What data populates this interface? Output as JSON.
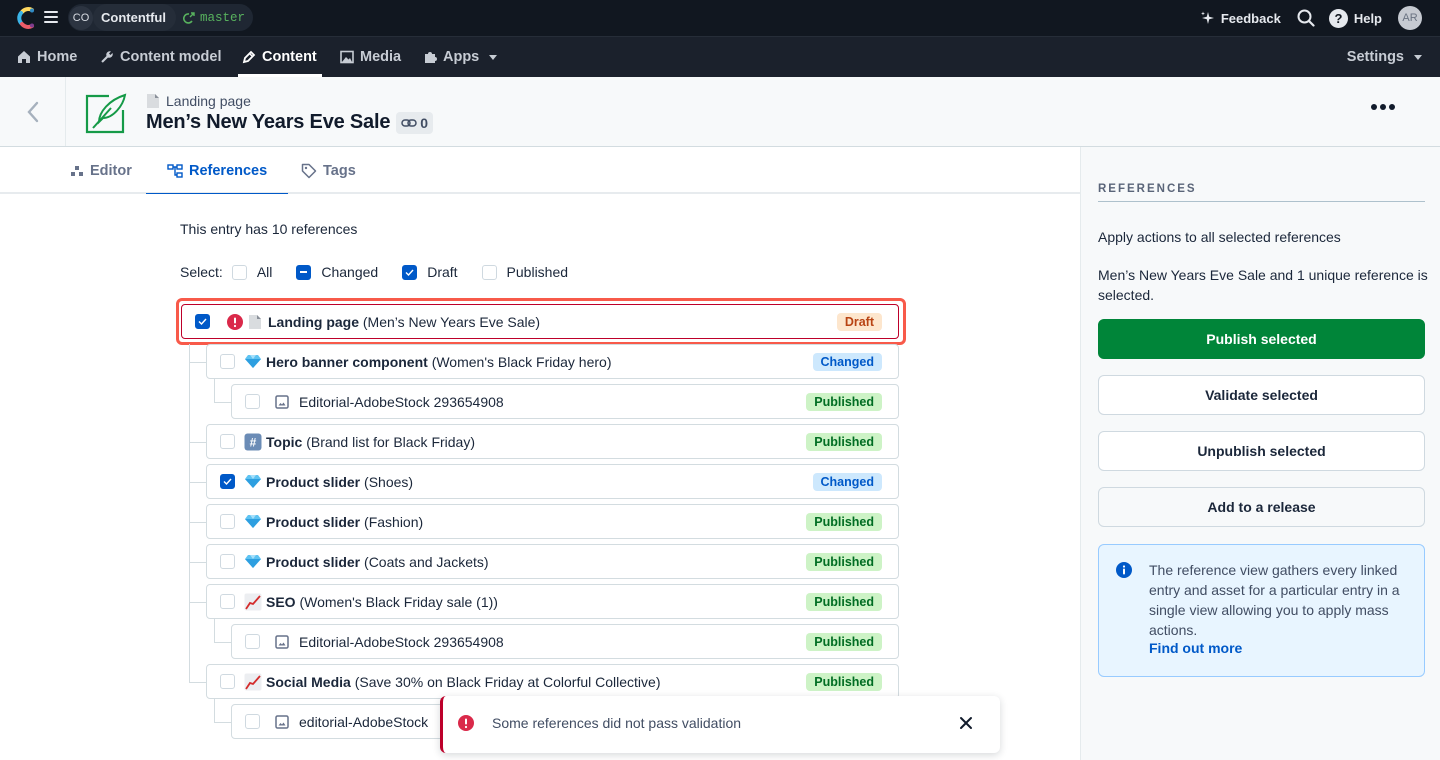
{
  "topbar": {
    "space_initials": "CO",
    "space_name": "Contentful",
    "environment": "master",
    "feedback_label": "Feedback",
    "help_label": "Help",
    "user_initials": "AR"
  },
  "nav": {
    "items": [
      {
        "label": "Home",
        "icon": "home-icon"
      },
      {
        "label": "Content model",
        "icon": "wrench-icon"
      },
      {
        "label": "Content",
        "icon": "pen-icon",
        "active": true
      },
      {
        "label": "Media",
        "icon": "image-icon"
      },
      {
        "label": "Apps",
        "icon": "puzzle-icon",
        "dropdown": true
      }
    ],
    "settings_label": "Settings"
  },
  "entry": {
    "content_type": "Landing page",
    "title": "Men’s New Years Eve Sale",
    "link_count": "0"
  },
  "tabs": [
    {
      "label": "Editor",
      "icon": "editor-icon"
    },
    {
      "label": "References",
      "icon": "references-icon",
      "active": true
    },
    {
      "label": "Tags",
      "icon": "tag-icon"
    }
  ],
  "references": {
    "summary": "This entry has 10 references",
    "select_label": "Select:",
    "select_options": [
      {
        "label": "All",
        "state": "unchecked"
      },
      {
        "label": "Changed",
        "state": "indeterminate"
      },
      {
        "label": "Draft",
        "state": "checked"
      },
      {
        "label": "Published",
        "state": "unchecked"
      }
    ],
    "items": [
      {
        "type": "Landing page",
        "name": "(Men’s New Years Eve Sale)",
        "status": "Draft",
        "checked": true,
        "error": true,
        "icon": "page-icon",
        "level": 0
      },
      {
        "type": "Hero banner component",
        "name": "(Women's Black Friday hero)",
        "status": "Changed",
        "checked": false,
        "icon": "gem-icon",
        "level": 1
      },
      {
        "type": "",
        "name": "Editorial-AdobeStock 293654908",
        "status": "Published",
        "checked": false,
        "icon": "image-icon",
        "level": 2
      },
      {
        "type": "Topic",
        "name": "(Brand list for Black Friday)",
        "status": "Published",
        "checked": false,
        "icon": "hash-icon",
        "level": 1
      },
      {
        "type": "Product slider",
        "name": "(Shoes)",
        "status": "Changed",
        "checked": true,
        "icon": "gem-icon",
        "level": 1
      },
      {
        "type": "Product slider",
        "name": "(Fashion)",
        "status": "Published",
        "checked": false,
        "icon": "gem-icon",
        "level": 1
      },
      {
        "type": "Product slider",
        "name": "(Coats and Jackets)",
        "status": "Published",
        "checked": false,
        "icon": "gem-icon",
        "level": 1
      },
      {
        "type": "SEO",
        "name": "(Women's Black Friday sale (1))",
        "status": "Published",
        "checked": false,
        "icon": "chart-icon",
        "level": 1
      },
      {
        "type": "",
        "name": "Editorial-AdobeStock 293654908",
        "status": "Published",
        "checked": false,
        "icon": "image-icon",
        "level": 2
      },
      {
        "type": "Social Media",
        "name": "(Save 30% on Black Friday at Colorful Collective)",
        "status": "Published",
        "checked": false,
        "icon": "chart-icon",
        "level": 1
      },
      {
        "type": "",
        "name": "editorial-AdobeStock",
        "status": "",
        "checked": false,
        "icon": "image-icon",
        "level": 2
      }
    ]
  },
  "toast": {
    "message": "Some references did not pass validation"
  },
  "sidebar": {
    "heading": "REFERENCES",
    "description": "Apply actions to all selected references",
    "selection_text": "Men’s New Years Eve Sale and 1 unique reference is selected.",
    "buttons": {
      "publish": "Publish selected",
      "validate": "Validate selected",
      "unpublish": "Unpublish selected",
      "release": "Add to a release"
    },
    "note": {
      "text": "The reference view gathers every linked entry and asset for a particular entry in a single view allowing you to apply mass actions.",
      "link": "Find out more"
    }
  },
  "colors": {
    "primary_blue": "#0059c8",
    "publish_green": "#008539",
    "error_red": "#bd002a",
    "highlight_outline": "#f85a4a"
  }
}
